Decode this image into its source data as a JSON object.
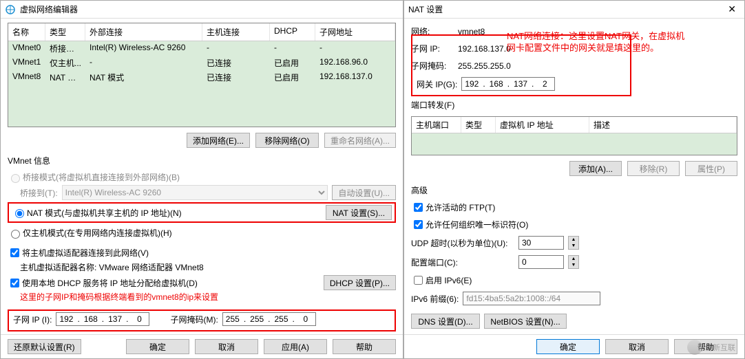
{
  "left": {
    "title": "虚拟网络编辑器",
    "cols": {
      "name": "名称",
      "type": "类型",
      "ext": "外部连接",
      "host": "主机连接",
      "dhcp": "DHCP",
      "sub": "子网地址"
    },
    "rows": [
      {
        "name": "VMnet0",
        "type": "桥接模式",
        "ext": "Intel(R) Wireless-AC 9260",
        "host": "-",
        "dhcp": "-",
        "sub": "-"
      },
      {
        "name": "VMnet1",
        "type": "仅主机...",
        "ext": "-",
        "host": "已连接",
        "dhcp": "已启用",
        "sub": "192.168.96.0"
      },
      {
        "name": "VMnet8",
        "type": "NAT 模式",
        "ext": "NAT 模式",
        "host": "已连接",
        "dhcp": "已启用",
        "sub": "192.168.137.0"
      }
    ],
    "btns": {
      "add": "添加网络(E)...",
      "remove": "移除网络(O)",
      "rename": "重命名网络(A)..."
    },
    "info_label": "VMnet 信息",
    "radio_bridge": "桥接模式(将虚拟机直接连接到外部网络)(B)",
    "bridge_to": "桥接到(T):",
    "bridge_adapter": "Intel(R) Wireless-AC 9260",
    "auto": "自动设置(U)...",
    "radio_nat": "NAT 模式(与虚拟机共享主机的 IP 地址)(N)",
    "nat_settings": "NAT 设置(S)...",
    "radio_host": "仅主机模式(在专用网络内连接虚拟机)(H)",
    "chk_connect": "将主机虚拟适配器连接到此网络(V)",
    "adapter_name": "主机虚拟适配器名称: VMware 网络适配器 VMnet8",
    "chk_dhcp": "使用本地 DHCP 服务将 IP 地址分配给虚拟机(D)",
    "dhcp_settings": "DHCP 设置(P)...",
    "annot_redline": "这里的子网IP和掩码根据终端看到的vmnet8的ip来设置",
    "subnet_label": "子网 IP (I):",
    "subnet_ip": [
      "192",
      "168",
      "137",
      "0"
    ],
    "mask_label": "子网掩码(M):",
    "mask": [
      "255",
      "255",
      "255",
      "0"
    ],
    "footer": {
      "restore": "还原默认设置(R)",
      "ok": "确定",
      "cancel": "取消",
      "apply": "应用(A)",
      "help": "帮助"
    }
  },
  "right": {
    "title": "NAT 设置",
    "net_label": "网络:",
    "net": "vmnet8",
    "sub_label": "子网 IP:",
    "sub": "192.168.137.0",
    "mask_label": "子网掩码:",
    "mask": "255.255.255.0",
    "annot1": "NAT网络连接：这里设置NAT网关，在虚拟机",
    "annot2": "网卡配置文件中的网关就是填这里的。",
    "gw_label": "网关 IP(G):",
    "gw": [
      "192",
      "168",
      "137",
      "2"
    ],
    "pf_label": "端口转发(F)",
    "pf_cols": {
      "hostport": "主机端口",
      "type": "类型",
      "vip": "虚拟机 IP 地址",
      "desc": "描述"
    },
    "pf_btns": {
      "add": "添加(A)...",
      "remove": "移除(R)",
      "prop": "属性(P)"
    },
    "adv_label": "高级",
    "chk_ftp": "允许活动的 FTP(T)",
    "chk_oui": "允许任何组织唯一标识符(O)",
    "udp_label": "UDP 超时(以秒为单位)(U):",
    "udp": "30",
    "cfgport_label": "配置端口(C):",
    "cfgport": "0",
    "chk_ipv6": "启用 IPv6(E)",
    "ipv6_label": "IPv6 前缀(6):",
    "ipv6": "fd15:4ba5:5a2b:1008::/64",
    "dns_btn": "DNS 设置(D)...",
    "netbios_btn": "NetBIOS 设置(N)...",
    "footer": {
      "ok": "确定",
      "cancel": "取消",
      "help": "帮助"
    }
  },
  "watermark": "创新互联"
}
